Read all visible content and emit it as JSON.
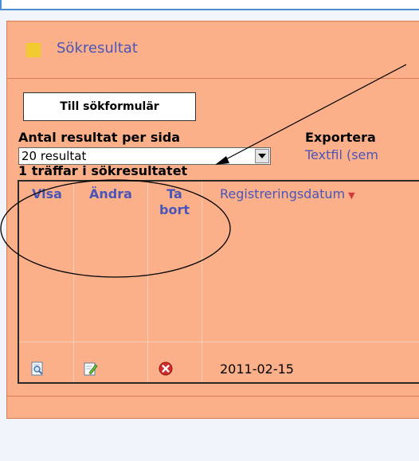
{
  "panel": {
    "title": "Sökresultat",
    "search_form_button": "Till sökformulär",
    "results_per_page_label": "Antal resultat per sida",
    "results_per_page_value": "20 resultat",
    "export_label": "Exportera",
    "export_link": "Textfil (sem",
    "hits_text": "1 träffar i sökresultatet"
  },
  "table": {
    "columns": {
      "view": "Visa",
      "edit": "Ändra",
      "delete_line1": "Ta",
      "delete_line2": "bort",
      "reg_date": "Registreringsdatum"
    },
    "rows": [
      {
        "reg_date": "2011-02-15"
      }
    ]
  },
  "icons": {
    "header": "yellow-square-icon",
    "view": "magnifier-document-icon",
    "edit": "pencil-document-icon",
    "delete": "red-x-circle-icon",
    "sort": "sort-descending-icon",
    "dropdown": "chevron-down-icon"
  },
  "colors": {
    "panel_bg": "#fbb089",
    "link": "#4a55b8",
    "header_square": "#f2cb2f",
    "delete_icon": "#d52b2b"
  }
}
